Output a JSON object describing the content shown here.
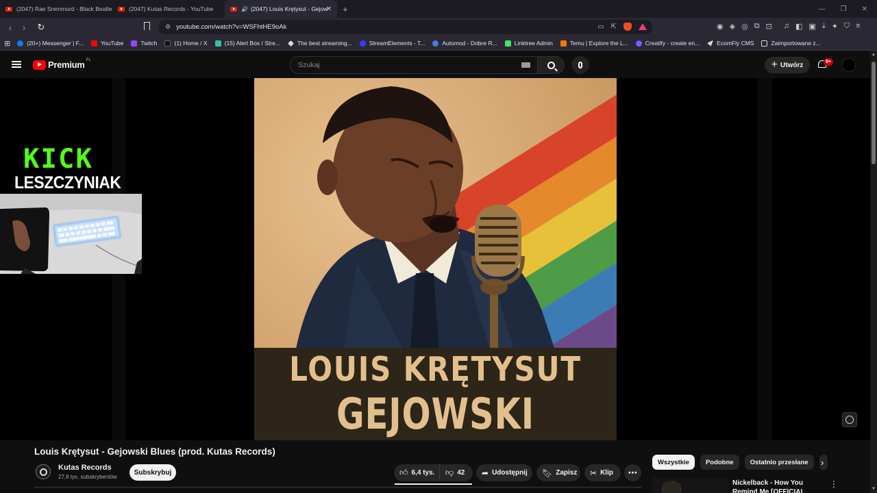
{
  "browser": {
    "tabs": [
      {
        "title": "(2047) Rae Sremmurd - Black Beatles"
      },
      {
        "title": "(2047) Kutas Records - YouTube"
      },
      {
        "title": "(2047) Louis Krętysut - Gejow",
        "active": true
      }
    ],
    "url": "youtube.com/watch?v=WSFhtHE9oAk",
    "bookmarks": [
      {
        "label": "(20+) Messenger | F...",
        "color": "#1877f2"
      },
      {
        "label": "YouTube",
        "color": "#ff0000"
      },
      {
        "label": "Twitch",
        "color": "#9146ff"
      },
      {
        "label": "(1) Home / X",
        "color": "#444444"
      },
      {
        "label": "(15) Alert Box / Stre...",
        "color": "#31c3a2"
      },
      {
        "label": "The best streaming...",
        "color": "#dddddd"
      },
      {
        "label": "StreamElements - T...",
        "color": "#3b3bff"
      },
      {
        "label": "Automod - Dobre R...",
        "color": "#4a7bd9"
      },
      {
        "label": "Linktree Admin",
        "color": "#43e660"
      },
      {
        "label": "Temu | Explore the L...",
        "color": "#fb7701"
      },
      {
        "label": "Creatify - create en...",
        "color": "#7b5cff"
      },
      {
        "label": "EcomFly CMS",
        "color": "#dddddd"
      },
      {
        "label": "Zaimportowane z...",
        "color": "#2a2933"
      }
    ]
  },
  "youtube": {
    "logo_text": "Premium",
    "logo_region": "PL",
    "search_placeholder": "Szukaj",
    "create_label": "Utwórz",
    "notifications": "9+"
  },
  "overlay": {
    "kick_logo": "KICK",
    "streamer": "LESZCZYNIAK"
  },
  "thumbnail": {
    "line1": "LOUIS KRĘTYSUT",
    "line2": "GEJOWSKI BLUES"
  },
  "video": {
    "title": "Louis Krętysut - Gejowski Blues (prod. Kutas Records)",
    "channel": "Kutas Records",
    "subscribers": "27,8 tys. subskrybentów",
    "subscribe_label": "Subskrybuj",
    "likes": "6,4 tys.",
    "dislikes": "42",
    "share_label": "Udostępnij",
    "save_label": "Zapisz",
    "clip_label": "Klip"
  },
  "sidebar": {
    "chips": [
      "Wszystkie",
      "Podobne",
      "Ostatnio przesłane"
    ],
    "recommendation_title": "Nickelback - How You Remind Me [OFFICIAL VIDEO]"
  }
}
